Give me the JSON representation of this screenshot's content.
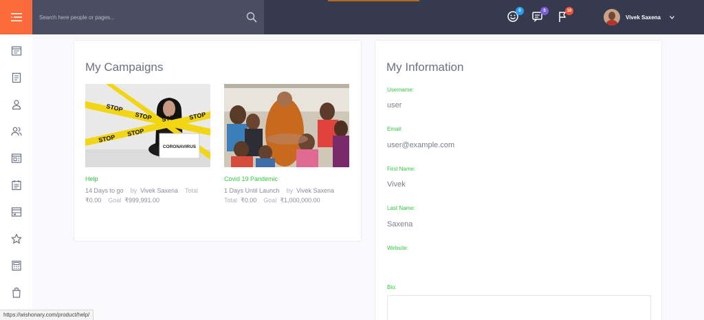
{
  "search": {
    "placeholder": "Search here people or pages..."
  },
  "notifications": [
    {
      "icon": "smiley-icon",
      "count": "0",
      "color": "#2a9df4"
    },
    {
      "icon": "chat-icon",
      "count": "0",
      "color": "#7d5fd3"
    },
    {
      "icon": "flag-icon",
      "count": "10",
      "color": "#f0533a"
    }
  ],
  "user": {
    "name": "Vivek Saxena"
  },
  "sidebar": {
    "items": [
      {
        "icon": "dashboard-icon"
      },
      {
        "icon": "document-icon"
      },
      {
        "icon": "user-icon"
      },
      {
        "icon": "users-icon"
      },
      {
        "icon": "browser-icon"
      },
      {
        "icon": "calendar-icon"
      },
      {
        "icon": "window-icon"
      },
      {
        "icon": "star-icon"
      },
      {
        "icon": "calculator-icon"
      },
      {
        "icon": "bag-icon"
      }
    ]
  },
  "campaigns": {
    "title": "My Campaigns",
    "items": [
      {
        "title": "Help",
        "days": "14 Days to go",
        "by_label": "by",
        "author": "Vivek Saxena",
        "total_label": "Total",
        "total": "₹0.00",
        "goal_label": "Goal",
        "goal": "₹999,991.00",
        "image": "woman-with-stop-tape-coronavirus-sign",
        "sign_text": "CORONAVIRUS",
        "tape_text": "STOP"
      },
      {
        "title": "Covid 19 Pandemic",
        "days": "1 Days Until Launch",
        "by_label": "by",
        "author": "Vivek Saxena",
        "total_label": "Total",
        "total": "₹0.00",
        "goal_label": "Goal",
        "goal": "₹1,000,000.00",
        "image": "monk-with-children-reaching-hands"
      }
    ]
  },
  "info": {
    "title": "My Information",
    "username_label": "Username:",
    "username": "user",
    "email_label": "Email:",
    "email": "user@example.com",
    "first_name_label": "First Name:",
    "first_name": "Vivek",
    "last_name_label": "Last Name:",
    "last_name": "Saxena",
    "website_label": "Website:",
    "website": "",
    "bio_label": "Bio:"
  },
  "status_bar": {
    "url": "https://wishonary.com/product/help/"
  },
  "colors": {
    "accent_orange": "#fa6a3a",
    "topbar": "#363a4f",
    "green_label": "#2ecc40"
  }
}
